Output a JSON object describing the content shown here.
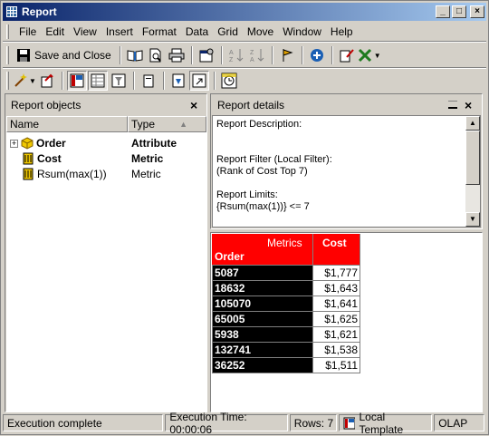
{
  "window": {
    "title": "Report"
  },
  "menu": [
    "File",
    "Edit",
    "View",
    "Insert",
    "Format",
    "Data",
    "Grid",
    "Move",
    "Window",
    "Help"
  ],
  "toolbar": {
    "save_close_label": "Save and Close"
  },
  "objects_pane": {
    "title": "Report objects",
    "columns": [
      "Name",
      "Type"
    ],
    "rows": [
      {
        "name": "Order",
        "type": "Attribute",
        "icon": "attribute-icon",
        "bold": true,
        "expandable": true
      },
      {
        "name": "Cost",
        "type": "Metric",
        "icon": "metric-icon",
        "bold": true,
        "expandable": false
      },
      {
        "name": "Rsum(max(1))",
        "type": "Metric",
        "icon": "metric-icon",
        "bold": false,
        "expandable": false
      }
    ]
  },
  "details_pane": {
    "title": "Report details",
    "lines": [
      "Report Description:",
      "",
      "",
      "Report Filter (Local Filter):",
      "(Rank of Cost Top 7)",
      "",
      "Report Limits:",
      "{Rsum(max(1))} <= 7"
    ]
  },
  "grid": {
    "corner_label": "Metrics",
    "row_header": "Order",
    "col_header": "Cost",
    "rows": [
      {
        "order": "5087",
        "cost": "$1,777"
      },
      {
        "order": "18632",
        "cost": "$1,643"
      },
      {
        "order": "105070",
        "cost": "$1,641"
      },
      {
        "order": "65005",
        "cost": "$1,625"
      },
      {
        "order": "5938",
        "cost": "$1,621"
      },
      {
        "order": "132741",
        "cost": "$1,538"
      },
      {
        "order": "36252",
        "cost": "$1,511"
      }
    ],
    "header_color": "#ff0000"
  },
  "status": {
    "message": "Execution complete",
    "exec_time": "Execution Time: 00:00:06",
    "rows": "Rows: 7",
    "template": "Local Template",
    "mode": "OLAP"
  }
}
